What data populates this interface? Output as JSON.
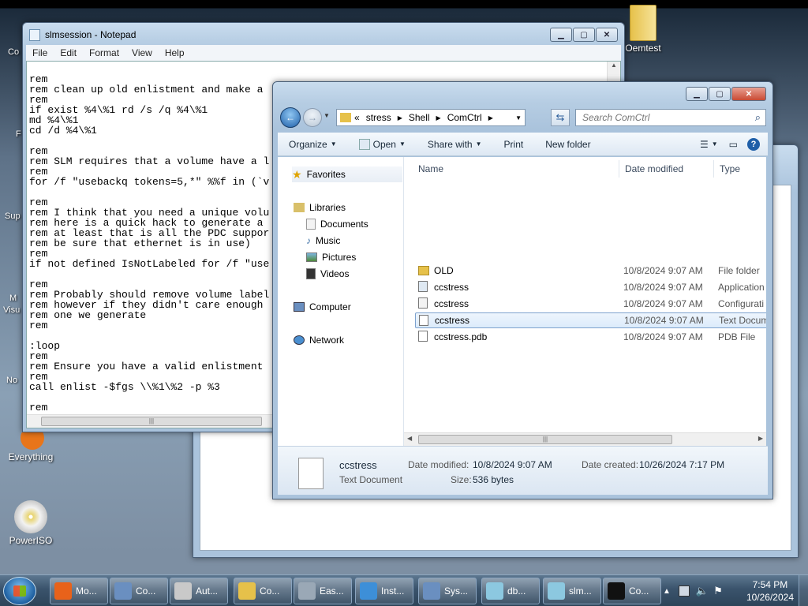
{
  "desktop": {
    "icons": [
      {
        "label": "Oemtest"
      },
      {
        "label": "Everything"
      },
      {
        "label": "PowerISO"
      }
    ],
    "partial_labels": [
      "Co",
      "F",
      "Sup",
      "M",
      "Visu",
      "No"
    ]
  },
  "notepad": {
    "title": "slmsession - Notepad",
    "menu": [
      "File",
      "Edit",
      "Format",
      "View",
      "Help"
    ],
    "text": "rem\nrem clean up old enlistment and make a\nrem\nif exist %4\\%1 rd /s /q %4\\%1\nmd %4\\%1\ncd /d %4\\%1\n\nrem\nrem SLM requires that a volume have a l\nrem\nfor /f \"usebackq tokens=5,*\" %%f in (`v\n\nrem\nrem I think that you need a unique volu\nrem here is a quick hack to generate a\nrem at least that is all the PDC suppor\nrem be sure that ethernet is in use)\nrem\nif not defined IsNotLabeled for /f \"use\n\nrem\nrem Probably should remove volume label\nrem however if they didn't care enough\nrem one we generate\nrem\n\n:loop\nrem\nrem Ensure you have a valid enlistment\nrem\ncall enlist -$fgs \\\\%1\\%2 -p %3\n\nrem"
  },
  "explorer": {
    "breadcrumb": [
      "«",
      "stress",
      "Shell",
      "ComCtrl"
    ],
    "search_placeholder": "Search ComCtrl",
    "toolbar": {
      "organize": "Organize",
      "open": "Open",
      "share_with": "Share with",
      "print": "Print",
      "new_folder": "New folder"
    },
    "nav": {
      "favorites": "Favorites",
      "libraries": "Libraries",
      "documents": "Documents",
      "music": "Music",
      "pictures": "Pictures",
      "videos": "Videos",
      "computer": "Computer",
      "network": "Network"
    },
    "columns": {
      "name": "Name",
      "date_modified": "Date modified",
      "type": "Type"
    },
    "files": [
      {
        "name": "OLD",
        "date": "10/8/2024 9:07 AM",
        "type": "File folder",
        "icon": "folder-icon"
      },
      {
        "name": "ccstress",
        "date": "10/8/2024 9:07 AM",
        "type": "Application",
        "icon": "application-icon"
      },
      {
        "name": "ccstress",
        "date": "10/8/2024 9:07 AM",
        "type": "Configurati",
        "icon": "config-file-icon"
      },
      {
        "name": "ccstress",
        "date": "10/8/2024 9:07 AM",
        "type": "Text Docum",
        "icon": "text-file-icon"
      },
      {
        "name": "ccstress.pdb",
        "date": "10/8/2024 9:07 AM",
        "type": "PDB File",
        "icon": "file-icon"
      }
    ],
    "details": {
      "name": "ccstress",
      "type": "Text Document",
      "date_modified_label": "Date modified:",
      "date_modified": "10/8/2024 9:07 AM",
      "date_created_label": "Date created:",
      "date_created": "10/26/2024 7:17 PM",
      "size_label": "Size:",
      "size": "536 bytes"
    }
  },
  "taskbar": {
    "buttons": [
      {
        "label": "Mo...",
        "icon": "firefox-icon",
        "color": "#e8621a"
      },
      {
        "label": "Co...",
        "icon": "computer-icon",
        "color": "#6a8fc0"
      },
      {
        "label": "Aut...",
        "icon": "printer-icon",
        "color": "#c9c9c9"
      },
      {
        "label": "Co...",
        "icon": "folder-icon",
        "color": "#e6c14a"
      },
      {
        "label": "Eas...",
        "icon": "app-icon",
        "color": "#9aa8b6"
      },
      {
        "label": "Inst...",
        "icon": "windows-flag-icon",
        "color": "#3d8fd8"
      },
      {
        "label": "Sys...",
        "icon": "system-icon",
        "color": "#6a8fc0"
      },
      {
        "label": "db...",
        "icon": "notepad-icon",
        "color": "#8cc8e0"
      },
      {
        "label": "slm...",
        "icon": "notepad-icon",
        "color": "#8cc8e0"
      },
      {
        "label": "Co...",
        "icon": "cmd-icon",
        "color": "#111111"
      }
    ],
    "time": "7:54 PM",
    "date": "10/26/2024"
  }
}
